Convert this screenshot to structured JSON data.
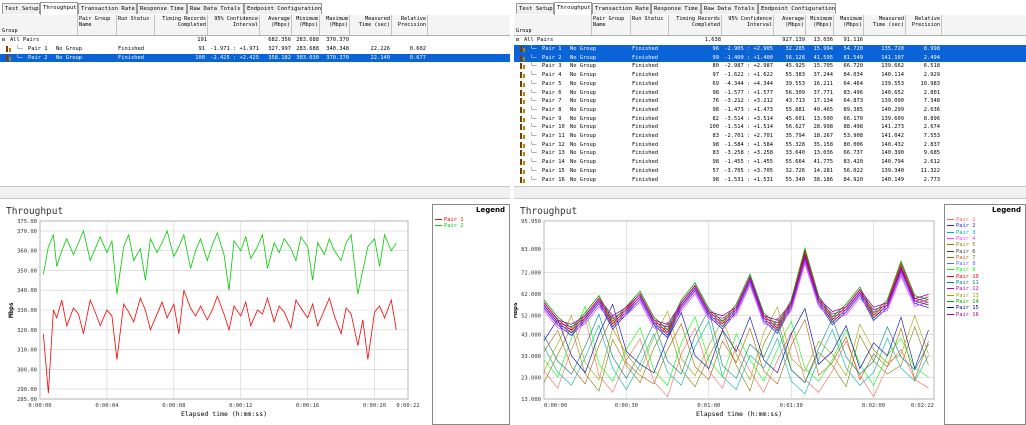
{
  "tabs": [
    "Test Setup",
    "Throughput",
    "Transaction Rate",
    "Response Time",
    "Raw Data Totals",
    "Endpoint Configuration"
  ],
  "active_tab": "Throughput",
  "columns": [
    "Group",
    "Pair Group Name",
    "Run Status",
    "Timing Records Completed",
    "95% Confidence Interval",
    "Average (Mbps)",
    "Minimum (Mbps)",
    "Maximum (Mbps)",
    "Measured Time (sec)",
    "Relative Precision"
  ],
  "left": {
    "all_pairs": {
      "label": "All Pairs",
      "records": "191",
      "average": "682.356",
      "minimum": "283.688",
      "maximum": "370.370"
    },
    "rows": [
      {
        "pair": "Pair 1",
        "group": "No Group",
        "status": "Finished",
        "records": "91",
        "ci": "-1.971 : +1.971",
        "average": "327.997",
        "minimum": "283.688",
        "maximum": "340.348",
        "time": "22.226",
        "precision": "0.602",
        "selected": false
      },
      {
        "pair": "Pair 2",
        "group": "No Group",
        "status": "Finished",
        "records": "100",
        "ci": "-2.425 : +2.425",
        "average": "358.182",
        "minimum": "303.030",
        "maximum": "370.370",
        "time": "22.140",
        "precision": "0.677",
        "selected": true
      }
    ],
    "chart": {
      "title": "Throughput",
      "ylabel": "Mbps",
      "xlabel": "Elapsed time (h:mm:ss)",
      "legend_title": "Legend"
    }
  },
  "right": {
    "all_pairs": {
      "label": "All Pairs",
      "records": "1,638",
      "average": "927.139",
      "minimum": "13.036",
      "maximum": "91.116"
    },
    "rows": [
      {
        "pair": "Pair 1",
        "group": "No Group",
        "status": "Finished",
        "records": "96",
        "ci": "-2.905 : +2.905",
        "average": "32.285",
        "minimum": "15.994",
        "maximum": "54.720",
        "time": "135.720",
        "precision": "8.998",
        "selected": true
      },
      {
        "pair": "Pair 2",
        "group": "No Group",
        "status": "Finished",
        "records": "99",
        "ci": "-1.400 : +1.400",
        "average": "56.128",
        "minimum": "41.595",
        "maximum": "81.549",
        "time": "141.107",
        "precision": "2.494",
        "selected": true
      },
      {
        "pair": "Pair 3",
        "group": "No Group",
        "status": "Finished",
        "records": "80",
        "ci": "-2.987 : +2.987",
        "average": "45.925",
        "minimum": "15.705",
        "maximum": "66.720",
        "time": "139.662",
        "precision": "6.518",
        "selected": false
      },
      {
        "pair": "Pair 4",
        "group": "No Group",
        "status": "Finished",
        "records": "97",
        "ci": "-1.622 : +1.622",
        "average": "55.383",
        "minimum": "37.244",
        "maximum": "84.034",
        "time": "140.114",
        "precision": "2.929",
        "selected": false
      },
      {
        "pair": "Pair 5",
        "group": "No Group",
        "status": "Finished",
        "records": "69",
        "ci": "-4.344 : +4.344",
        "average": "39.553",
        "minimum": "16.211",
        "maximum": "64.464",
        "time": "139.553",
        "precision": "10.983",
        "selected": false
      },
      {
        "pair": "Pair 6",
        "group": "No Group",
        "status": "Finished",
        "records": "98",
        "ci": "-1.577 : +1.577",
        "average": "56.309",
        "minimum": "37.771",
        "maximum": "83.496",
        "time": "140.652",
        "precision": "2.801",
        "selected": false
      },
      {
        "pair": "Pair 7",
        "group": "No Group",
        "status": "Finished",
        "records": "76",
        "ci": "-3.212 : +3.212",
        "average": "43.713",
        "minimum": "17.134",
        "maximum": "64.873",
        "time": "139.090",
        "precision": "7.348",
        "selected": false
      },
      {
        "pair": "Pair 8",
        "group": "No Group",
        "status": "Finished",
        "records": "98",
        "ci": "-1.473 : +1.473",
        "average": "55.881",
        "minimum": "40.465",
        "maximum": "89.385",
        "time": "140.299",
        "precision": "2.636",
        "selected": false
      },
      {
        "pair": "Pair 9",
        "group": "No Group",
        "status": "Finished",
        "records": "82",
        "ci": "-3.514 : +3.514",
        "average": "45.601",
        "minimum": "13.500",
        "maximum": "66.170",
        "time": "139.609",
        "precision": "8.896",
        "selected": false
      },
      {
        "pair": "Pair 10",
        "group": "No Group",
        "status": "Finished",
        "records": "100",
        "ci": "-1.514 : +1.514",
        "average": "56.627",
        "minimum": "28.998",
        "maximum": "88.498",
        "time": "141.273",
        "precision": "2.674",
        "selected": false
      },
      {
        "pair": "Pair 11",
        "group": "No Group",
        "status": "Finished",
        "records": "83",
        "ci": "-2.701 : +2.701",
        "average": "35.794",
        "minimum": "18.267",
        "maximum": "53.908",
        "time": "141.042",
        "precision": "7.553",
        "selected": false
      },
      {
        "pair": "Pair 12",
        "group": "No Group",
        "status": "Finished",
        "records": "98",
        "ci": "-1.584 : +1.584",
        "average": "55.328",
        "minimum": "35.158",
        "maximum": "80.006",
        "time": "140.432",
        "precision": "2.837",
        "selected": false
      },
      {
        "pair": "Pair 13",
        "group": "No Group",
        "status": "Finished",
        "records": "83",
        "ci": "-3.258 : +3.258",
        "average": "33.640",
        "minimum": "13.036",
        "maximum": "66.737",
        "time": "140.390",
        "precision": "9.685",
        "selected": false
      },
      {
        "pair": "Pair 14",
        "group": "No Group",
        "status": "Finished",
        "records": "98",
        "ci": "-1.455 : +1.455",
        "average": "55.664",
        "minimum": "41.775",
        "maximum": "83.420",
        "time": "140.794",
        "precision": "2.612",
        "selected": false
      },
      {
        "pair": "Pair 15",
        "group": "No Group",
        "status": "Finished",
        "records": "57",
        "ci": "-3.705 : +3.705",
        "average": "32.726",
        "minimum": "14.281",
        "maximum": "56.022",
        "time": "139.340",
        "precision": "11.322",
        "selected": false
      },
      {
        "pair": "Pair 16",
        "group": "No Group",
        "status": "Finished",
        "records": "98",
        "ci": "-1.531 : +1.531",
        "average": "55.340",
        "minimum": "38.186",
        "maximum": "84.920",
        "time": "140.149",
        "precision": "2.773",
        "selected": false
      }
    ],
    "chart": {
      "title": "Throughput",
      "ylabel": "Mbps",
      "xlabel": "Elapsed time (h:mm:ss)",
      "legend_title": "Legend"
    }
  },
  "chart_data": [
    {
      "type": "line",
      "title": "Throughput",
      "xlabel": "Elapsed time (h:mm:ss)",
      "ylabel": "Mbps",
      "ylim": [
        285,
        375
      ],
      "xlim": [
        0,
        22
      ],
      "y_ticks": [
        "375.00",
        "370.00",
        "360.00",
        "350.00",
        "340.00",
        "330.00",
        "320.00",
        "310.00",
        "300.00",
        "290.00",
        "285.00"
      ],
      "y_tick_values": [
        375,
        370,
        360,
        350,
        340,
        330,
        320,
        310,
        300,
        290,
        285
      ],
      "x_ticks": [
        "0:00:00",
        "0:00:04",
        "0:00:08",
        "0:00:12",
        "0:00:16",
        "0:00:20",
        "0:00:22"
      ],
      "x_tick_values": [
        0,
        4,
        8,
        12,
        16,
        20,
        22
      ],
      "series": [
        {
          "name": "Pair 1",
          "color": "#ff0000",
          "x": [
            0.2,
            0.5,
            0.8,
            1.0,
            1.3,
            1.6,
            2.0,
            2.3,
            2.6,
            3.0,
            3.3,
            3.6,
            4.0,
            4.3,
            4.6,
            5.0,
            5.3,
            5.6,
            6.0,
            6.3,
            6.6,
            7.0,
            7.3,
            7.6,
            8.0,
            8.3,
            8.6,
            9.0,
            9.3,
            9.6,
            10.0,
            10.3,
            10.6,
            11.0,
            11.3,
            11.6,
            12.0,
            12.3,
            12.6,
            13.0,
            13.3,
            13.6,
            14.0,
            14.3,
            14.6,
            15.0,
            15.3,
            15.6,
            16.0,
            16.3,
            16.6,
            17.0,
            17.3,
            17.6,
            18.0,
            18.3,
            18.6,
            19.0,
            19.3,
            19.6,
            20.0,
            20.3,
            20.6,
            21.0,
            21.3
          ],
          "values": [
            318,
            288,
            330,
            326,
            335,
            322,
            331,
            328,
            318,
            335,
            329,
            322,
            330,
            327,
            305,
            333,
            329,
            324,
            336,
            330,
            320,
            328,
            334,
            326,
            333,
            318,
            340,
            331,
            327,
            332,
            325,
            330,
            337,
            328,
            320,
            332,
            327,
            334,
            322,
            330,
            328,
            336,
            324,
            332,
            329,
            321,
            335,
            331,
            326,
            333,
            322,
            330,
            336,
            327,
            318,
            331,
            328,
            312,
            325,
            305,
            329,
            332,
            326,
            335,
            320
          ]
        },
        {
          "name": "Pair 2",
          "color": "#00cc00",
          "x": [
            0.2,
            0.5,
            0.8,
            1.0,
            1.3,
            1.6,
            2.0,
            2.3,
            2.6,
            3.0,
            3.3,
            3.6,
            4.0,
            4.3,
            4.6,
            5.0,
            5.3,
            5.6,
            6.0,
            6.3,
            6.6,
            7.0,
            7.3,
            7.6,
            8.0,
            8.3,
            8.6,
            9.0,
            9.3,
            9.6,
            10.0,
            10.3,
            10.6,
            11.0,
            11.3,
            11.6,
            12.0,
            12.3,
            12.6,
            13.0,
            13.3,
            13.6,
            14.0,
            14.3,
            14.6,
            15.0,
            15.3,
            15.6,
            16.0,
            16.3,
            16.6,
            17.0,
            17.3,
            17.6,
            18.0,
            18.3,
            18.6,
            19.0,
            19.3,
            19.6,
            20.0,
            20.3,
            20.6,
            21.0,
            21.3
          ],
          "values": [
            348,
            362,
            368,
            352,
            360,
            366,
            358,
            364,
            370,
            355,
            361,
            367,
            359,
            365,
            338,
            362,
            368,
            355,
            361,
            345,
            366,
            359,
            364,
            370,
            357,
            362,
            368,
            351,
            360,
            366,
            355,
            363,
            369,
            358,
            340,
            365,
            360,
            367,
            356,
            362,
            368,
            351,
            364,
            359,
            366,
            361,
            355,
            367,
            362,
            345,
            364,
            358,
            366,
            360,
            355,
            364,
            368,
            338,
            350,
            362,
            366,
            352,
            368,
            360,
            364
          ]
        }
      ]
    },
    {
      "type": "line",
      "title": "Throughput",
      "xlabel": "Elapsed time (h:mm:ss)",
      "ylabel": "Mbps",
      "ylim": [
        13,
        96
      ],
      "xlim": [
        0,
        142
      ],
      "y_ticks": [
        "95.950",
        "83.000",
        "72.000",
        "62.000",
        "52.000",
        "43.000",
        "33.000",
        "23.000",
        "13.000"
      ],
      "y_tick_values": [
        95.95,
        83,
        72,
        62,
        52,
        43,
        33,
        23,
        13
      ],
      "x_ticks": [
        "0:00:00",
        "0:00:30",
        "0:01:00",
        "0:01:30",
        "0:02:00",
        "0:02:22"
      ],
      "x_tick_values": [
        0,
        30,
        60,
        90,
        120,
        142
      ],
      "x_tick_anchors": [
        "start",
        "middle",
        "middle",
        "middle",
        "middle",
        "end"
      ],
      "series_colors": [
        "#ff6060",
        "#2020ff",
        "#00b0b0",
        "#ff40ff",
        "#808000",
        "#404040",
        "#b06000",
        "#6060ff",
        "#00ff00",
        "#ff0000",
        "#008080",
        "#c000c0",
        "#a0a000",
        "#00a000",
        "#0000a0",
        "#a000a0"
      ],
      "series_names": [
        "Pair 1",
        "Pair 2",
        "Pair 3",
        "Pair 4",
        "Pair 5",
        "Pair 6",
        "Pair 7",
        "Pair 8",
        "Pair 9",
        "Pair 10",
        "Pair 11",
        "Pair 12",
        "Pair 13",
        "Pair 14",
        "Pair 15",
        "Pair 16"
      ],
      "x": [
        0,
        5,
        10,
        15,
        20,
        25,
        30,
        35,
        40,
        45,
        50,
        55,
        60,
        65,
        70,
        75,
        80,
        85,
        90,
        95,
        100,
        105,
        110,
        115,
        120,
        125,
        130,
        135,
        140
      ],
      "strong_series": [
        [
          58,
          50,
          45,
          52,
          60,
          48,
          55,
          62,
          50,
          44,
          58,
          66,
          54,
          48,
          56,
          70,
          52,
          46,
          58,
          82,
          60,
          50,
          56,
          64,
          52,
          58,
          76,
          60,
          58
        ],
        [
          56,
          48,
          46,
          50,
          58,
          50,
          54,
          60,
          48,
          46,
          56,
          64,
          52,
          50,
          54,
          68,
          50,
          48,
          56,
          78,
          58,
          52,
          54,
          62,
          54,
          56,
          72,
          58,
          60
        ]
      ],
      "weak_series": [
        [
          30,
          22,
          40,
          55,
          28,
          20,
          35,
          45,
          25,
          18,
          38,
          50,
          30,
          22,
          42,
          30,
          20,
          35,
          48,
          26,
          20,
          30,
          44,
          28,
          18,
          32,
          40,
          26,
          22
        ],
        [
          40,
          28,
          22,
          35,
          50,
          30,
          20,
          32,
          46,
          28,
          22,
          40,
          52,
          26,
          20,
          36,
          30,
          44,
          24,
          18,
          34,
          48,
          30,
          22,
          28,
          44,
          30,
          24,
          36
        ],
        [
          22,
          35,
          48,
          26,
          18,
          42,
          30,
          22,
          38,
          50,
          28,
          20,
          34,
          46,
          30,
          18,
          40,
          52,
          28,
          22,
          36,
          30,
          20,
          44,
          32,
          26,
          30,
          48,
          30
        ],
        [
          35,
          45,
          28,
          20,
          38,
          52,
          30,
          24,
          20,
          36,
          48,
          28,
          22,
          40,
          30,
          46,
          26,
          20,
          38,
          50,
          24,
          30,
          42,
          22,
          34,
          28,
          46,
          22,
          40
        ]
      ]
    }
  ]
}
